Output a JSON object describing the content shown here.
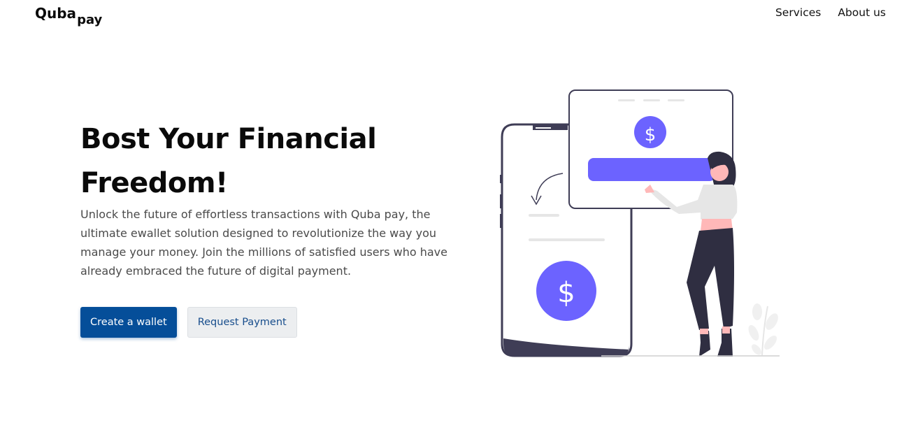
{
  "header": {
    "logo_main": "Quba",
    "logo_sub": "pay",
    "nav": [
      {
        "label": "Services"
      },
      {
        "label": "About us"
      }
    ]
  },
  "hero": {
    "title": "Bost Your Financial Freedom!",
    "description": "Unlock the future of effortless transactions with Quba pay, the ultimate ewallet solution designed to revolutionize the way you manage your money. Join the millions of satisfied users who have already embraced the future of digital payment.",
    "primary_button": "Create a wallet",
    "secondary_button": "Request Payment"
  },
  "illustration": {
    "currency_symbol": "$",
    "colors": {
      "accent": "#6c63ff",
      "outline": "#3f3d56",
      "dark": "#2f2e41",
      "skin": "#ffb8b8",
      "light_gray": "#e6e6e6"
    }
  },
  "colors": {
    "primary_button_bg": "#054e99",
    "secondary_button_bg": "#eceef0",
    "secondary_button_text": "#174d8c"
  }
}
